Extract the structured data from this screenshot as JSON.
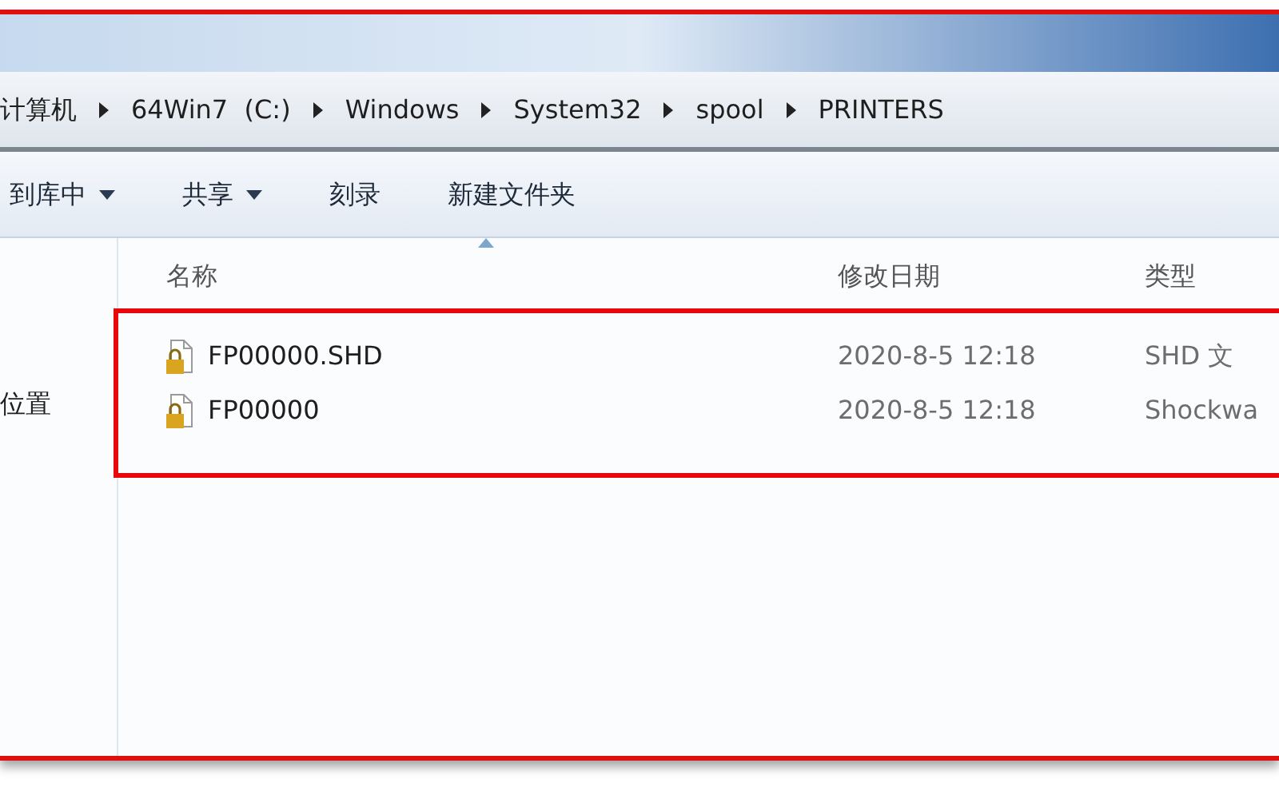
{
  "breadcrumb": [
    "计算机",
    "64Win7  (C:)",
    "Windows",
    "System32",
    "spool",
    "PRINTERS"
  ],
  "toolbar": [
    {
      "label": "到库中",
      "dropdown": true
    },
    {
      "label": "共享",
      "dropdown": true
    },
    {
      "label": "刻录",
      "dropdown": false
    },
    {
      "label": "新建文件夹",
      "dropdown": false
    }
  ],
  "sidebar": {
    "items": [
      "位置"
    ]
  },
  "table": {
    "columns": [
      {
        "label": "名称",
        "sorted": true
      },
      {
        "label": "修改日期",
        "sorted": false
      },
      {
        "label": "类型",
        "sorted": false
      }
    ],
    "rows": [
      [
        "FP00000.SHD",
        "2020-8-5 12:18",
        "SHD 文"
      ],
      [
        "FP00000",
        "2020-8-5 12:18",
        "Shockwa"
      ]
    ]
  }
}
